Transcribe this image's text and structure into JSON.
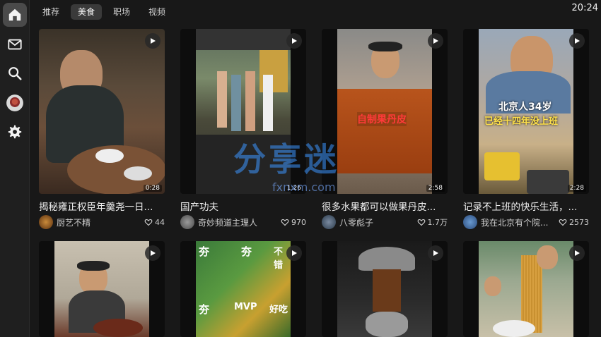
{
  "tabs": [
    {
      "label": "推荐",
      "active": false
    },
    {
      "label": "美食",
      "active": true
    },
    {
      "label": "职场",
      "active": false
    },
    {
      "label": "视频",
      "active": false
    }
  ],
  "clock": "20:24",
  "sidebar": [
    {
      "icon": "home-icon",
      "active": true
    },
    {
      "icon": "mail-icon",
      "active": false
    },
    {
      "icon": "search-icon",
      "active": false
    },
    {
      "icon": "bowl-icon",
      "active": false
    },
    {
      "icon": "gear-icon",
      "active": false
    }
  ],
  "cards": [
    {
      "title": "揭秘雍正权臣年羹尧一日...",
      "author": "厨艺不精",
      "likes": "44",
      "duration": "0:28"
    },
    {
      "title": "国产功夫",
      "author": "奇妙频道主理人",
      "likes": "970",
      "duration": "1:26"
    },
    {
      "title": "很多水果都可以做果丹皮...",
      "author": "八零彪子",
      "likes": "1.7万",
      "duration": "2:58",
      "overlay": "自制果丹皮"
    },
    {
      "title": "记录不上班的快乐生活，...",
      "author": "我在北京有个院...",
      "likes": "2573",
      "duration": "2:28",
      "overlay1": "北京人34岁",
      "overlay2": "已经十四年没上班"
    },
    {},
    {
      "overlays": [
        "夯",
        "夯",
        "不错",
        "夯",
        "MVP",
        "好吃"
      ]
    },
    {},
    {}
  ],
  "watermark": {
    "main": "分享迷",
    "url": "fxnxm.com"
  }
}
